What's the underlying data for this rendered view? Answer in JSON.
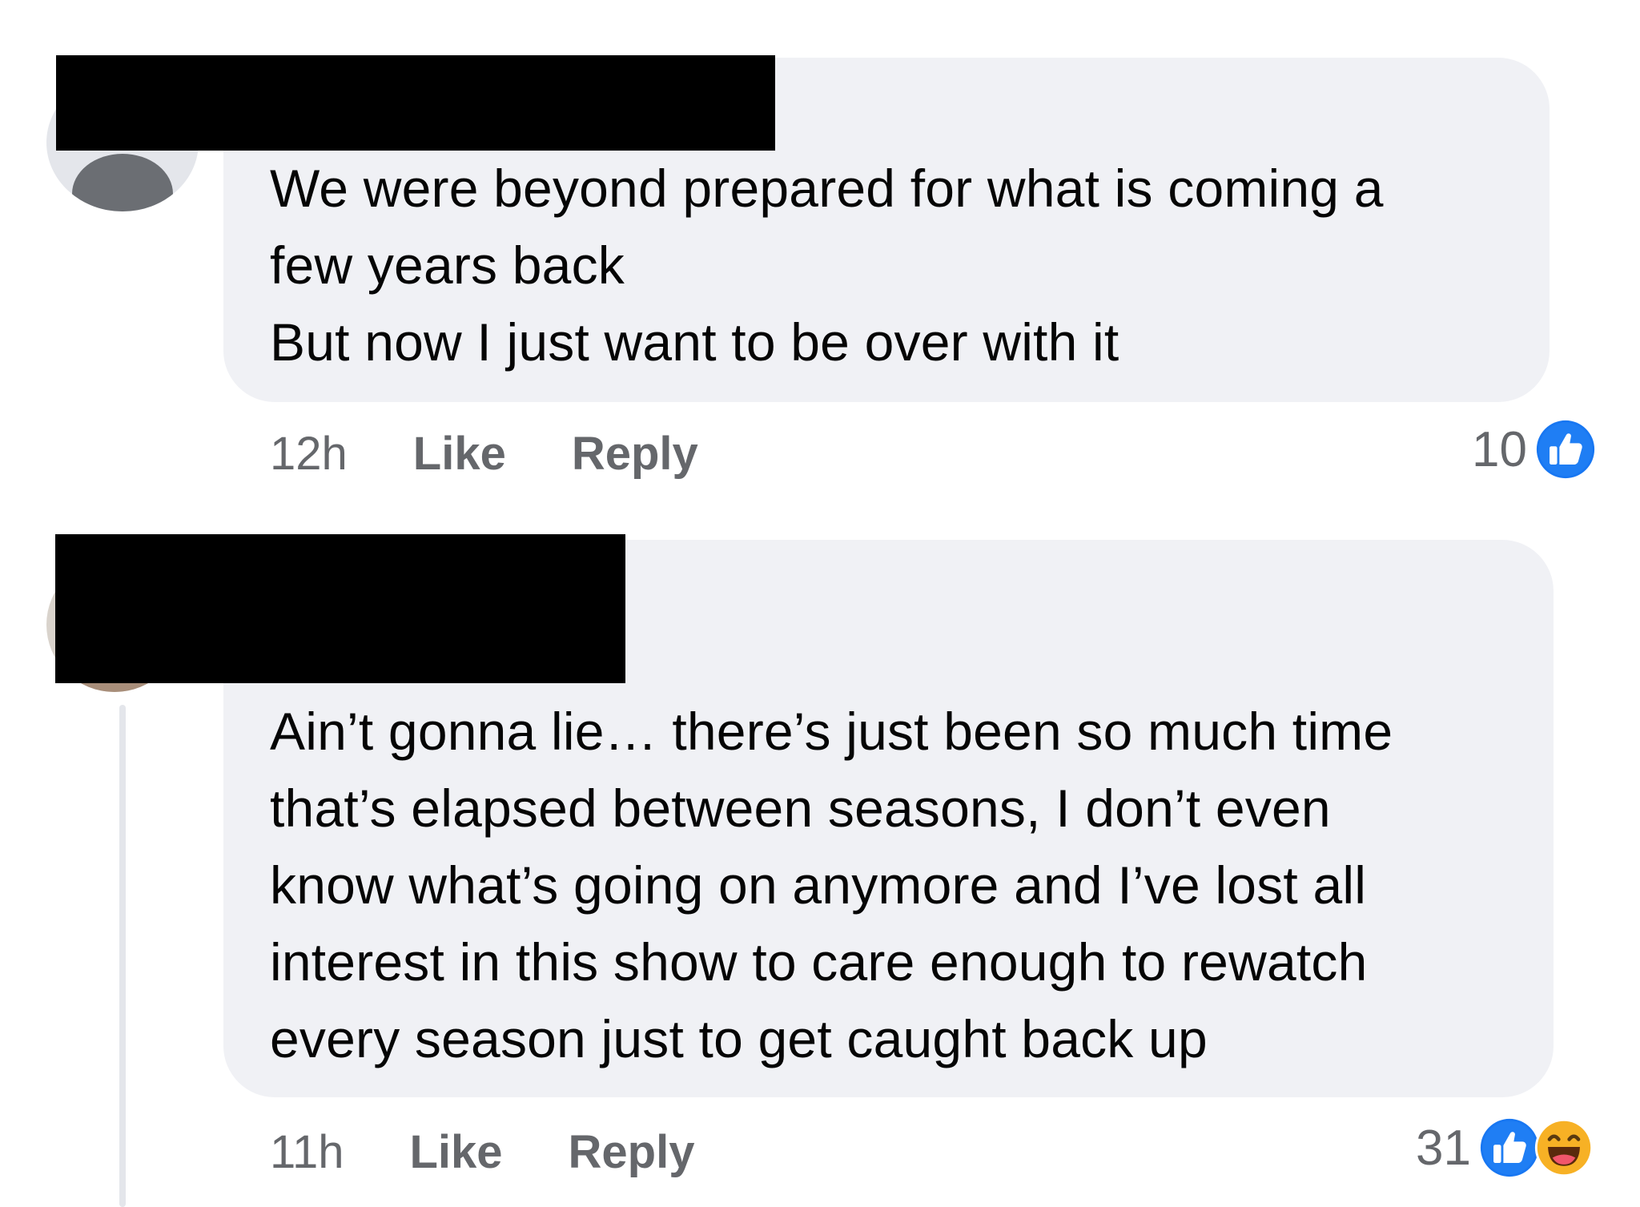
{
  "comments": [
    {
      "text": "We were beyond prepared for what is coming a\nfew years back\nBut now I just want to be over with it",
      "time": "12h",
      "like_label": "Like",
      "reply_label": "Reply",
      "reaction_count": "10",
      "reactions": [
        "like-icon"
      ]
    },
    {
      "text": "Ain’t gonna lie… there’s just been so much time\nthat’s elapsed between seasons, I don’t even\nknow what’s going on anymore and I’ve lost all\ninterest in this show to care enough to rewatch\nevery season just to get caught back up",
      "time": "11h",
      "like_label": "Like",
      "reply_label": "Reply",
      "reaction_count": "31",
      "reactions": [
        "like-icon",
        "haha-icon"
      ]
    }
  ],
  "colors": {
    "bubble": "#f0f1f5",
    "meta_text": "#65676b",
    "like_blue": "#1877f2",
    "haha_yellow": "#f7b125",
    "redaction": "#000000"
  }
}
